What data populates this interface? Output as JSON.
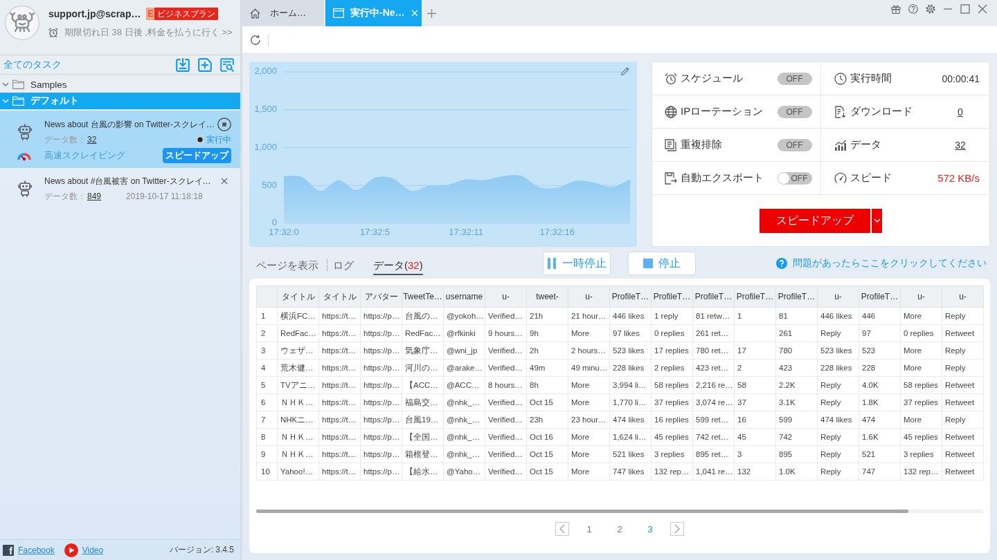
{
  "sidebar": {
    "account": {
      "name": "support.jp@scrap…",
      "plan_initial": "E",
      "plan": "ビジネスプラン",
      "expiry": "期限切れ日 38 日後 ,料金を払うに行く >>"
    },
    "tasks_header": "全てのタスク",
    "tree": [
      {
        "label": "Samples",
        "expanded": true,
        "selected": false
      },
      {
        "label": "デフォルト",
        "expanded": true,
        "selected": true,
        "children": [
          {
            "title": "News about 台風の影響 on Twitter-スクレイ…",
            "selected": true,
            "running": true,
            "count_label": "データ数：",
            "count": "32",
            "status": "実行中",
            "mode": "高速スクレイピング",
            "action": "スピードアップ"
          },
          {
            "title": "News about #台風被害 on Twitter-スクレイ…",
            "selected": false,
            "running": false,
            "count_label": "データ数：",
            "count": "849",
            "date": "2019-10-17 11:18:18"
          }
        ]
      }
    ],
    "footer": {
      "links": [
        {
          "kind": "facebook",
          "icon": "f",
          "label": "Facebook"
        },
        {
          "kind": "video",
          "label": "Video"
        }
      ],
      "version": "バージョン: 3.4.5"
    }
  },
  "tabs": [
    {
      "kind": "home",
      "label": "ホーム…",
      "selected": false,
      "closable": false
    },
    {
      "kind": "task",
      "label": "実行中-Ne…",
      "selected": true,
      "closable": true
    }
  ],
  "chart": {
    "chart_data": {
      "type": "area",
      "grid": true,
      "categories": [
        "17:32:0",
        null,
        null,
        null,
        null,
        "17:32:5",
        null,
        null,
        null,
        null,
        "17:32:11",
        null,
        null,
        null,
        null,
        "17:32:16",
        null,
        null,
        null,
        null
      ],
      "values": [
        620,
        610,
        430,
        570,
        440,
        600,
        590,
        430,
        500,
        510,
        580,
        570,
        620,
        630,
        480,
        470,
        560,
        540,
        480,
        580
      ],
      "ylim": [
        0,
        2000
      ],
      "yticks": [
        {
          "value": 0,
          "label": "0"
        },
        {
          "value": 500,
          "label": "500"
        },
        {
          "value": 1000,
          "label": "1,000"
        },
        {
          "value": 1500,
          "label": "1,500"
        },
        {
          "value": 2000,
          "label": "2,000"
        }
      ]
    }
  },
  "run_settings": [
    {
      "label": "スケジュール",
      "kind": "status",
      "on": false,
      "state_text": "OFF"
    },
    {
      "label": "IPローテーション",
      "kind": "status",
      "on": false,
      "state_text": "OFF"
    },
    {
      "label": "重複排除",
      "kind": "status",
      "on": false,
      "state_text": "OFF"
    },
    {
      "label": "自動エクスポート",
      "kind": "switch",
      "on": false,
      "state_text": "OFF"
    }
  ],
  "run_stats": [
    {
      "label": "実行時間",
      "kind": "plain",
      "value": "00:00:41"
    },
    {
      "label": "ダウンロード",
      "kind": "link",
      "value": "0"
    },
    {
      "label": "データ",
      "kind": "link",
      "value": "32"
    },
    {
      "label": "スピード",
      "kind": "alert",
      "value": "572 KB/s"
    }
  ],
  "speed_up_button": {
    "label": "スピードアップ"
  },
  "view_tabs": [
    {
      "label": "ページを表示",
      "selected": false
    },
    {
      "label": "ログ",
      "selected": false
    },
    {
      "label": "データ(",
      "count": "32",
      "label_end": ")",
      "selected": true
    }
  ],
  "run_controls": [
    {
      "kind": "pause",
      "label": "一時停止"
    },
    {
      "kind": "stop",
      "label": "停止"
    }
  ],
  "help_link": "問題があったらここをクリックしてください",
  "table": {
    "columns": [
      "",
      "タイトル",
      "タイトル",
      "アバター",
      "TweetTe…",
      "username",
      "u-",
      "tweet-",
      "u-",
      "ProfileT…",
      "ProfileT…",
      "ProfileT…",
      "ProfileT…",
      "ProfileT…",
      "u-",
      "ProfileT…",
      "u-",
      "u-"
    ],
    "rows": [
      [
        "1",
        "横浜FC…",
        "https://t…",
        "https://p…",
        "台風の…",
        "@yokoh…",
        "Verified…",
        "21h",
        "21 hour…",
        "446 likes",
        "1 reply",
        "81 retw…",
        "1",
        "81",
        "446 likes",
        "446",
        "More",
        "Reply"
      ],
      [
        "2",
        "RedFac…",
        "https://t…",
        "https://p…",
        "RedFac…",
        "@rfkinki",
        "9 hours…",
        "9h",
        "More",
        "97 likes",
        "0 replies",
        "261 ret…",
        null,
        "261",
        "Reply",
        "97",
        "0 replies",
        "Retweet"
      ],
      [
        "3",
        "ウェザ…",
        "https://t…",
        "https://p…",
        "気象庁…",
        "@wni_jp",
        "Verified…",
        "2h",
        "2 hours…",
        "523 likes",
        "17 replies",
        "780 ret…",
        "17",
        "780",
        "523 likes",
        "523",
        "More",
        "Reply"
      ],
      [
        "4",
        "荒木健…",
        "https://t…",
        "https://p…",
        "河川の…",
        "@arake…",
        "Verified…",
        "49m",
        "49 minu…",
        "228 likes",
        "2 replies",
        "423 ret…",
        "2",
        "423",
        "228 likes",
        "228",
        "More",
        "Reply"
      ],
      [
        "5",
        "TVアニ…",
        "https://t…",
        "https://p…",
        "【ACC…",
        "@ACC…",
        "8 hours…",
        "8h",
        "More",
        "3,994 li…",
        "58 replies",
        "2,216 re…",
        "58",
        "2.2K",
        "Reply",
        "4.0K",
        "58 replies",
        "Retweet"
      ],
      [
        "6",
        "ＮＨＫ…",
        "https://t…",
        "https://p…",
        "福島交…",
        "@nhk_…",
        "Verified…",
        "Oct 15",
        "More",
        "1,770 li…",
        "37 replies",
        "3,074 re…",
        "37",
        "3.1K",
        "Reply",
        "1.8K",
        "37 replies",
        "Retweet"
      ],
      [
        "7",
        "NHKニ…",
        "https://t…",
        "https://p…",
        "台風19…",
        "@nhk_…",
        "Verified…",
        "23h",
        "23 hour…",
        "474 likes",
        "16 replies",
        "599 ret…",
        "16",
        "599",
        "474 likes",
        "474",
        "More",
        "Reply"
      ],
      [
        "8",
        "ＮＨＫ…",
        "https://t…",
        "https://p…",
        "【全国…",
        "@nhk_…",
        "Verified…",
        "Oct 16",
        "More",
        "1,624 li…",
        "45 replies",
        "742 ret…",
        "45",
        "742",
        "Reply",
        "1.6K",
        "45 replies",
        "Retweet"
      ],
      [
        "9",
        "ＮＨＫ…",
        "https://t…",
        "https://p…",
        "箱根登…",
        "@nhk_…",
        "Verified…",
        "Oct 15",
        "More",
        "521 likes",
        "3 replies",
        "895 ret…",
        "3",
        "895",
        "Reply",
        "521",
        "3 replies",
        "Retweet"
      ],
      [
        "10",
        "Yahoo!…",
        "https://t…",
        "https://p…",
        "【給水…",
        "@Yaho…",
        "Verified…",
        "Oct 15",
        "More",
        "747 likes",
        "132 rep…",
        "1,041 re…",
        "132",
        "1.0K",
        "Reply",
        "747",
        "132 rep…",
        "Retweet"
      ]
    ]
  },
  "pagination": [
    {
      "label": "1",
      "selected": false
    },
    {
      "label": "2",
      "selected": false
    },
    {
      "label": "3",
      "selected": true
    }
  ]
}
